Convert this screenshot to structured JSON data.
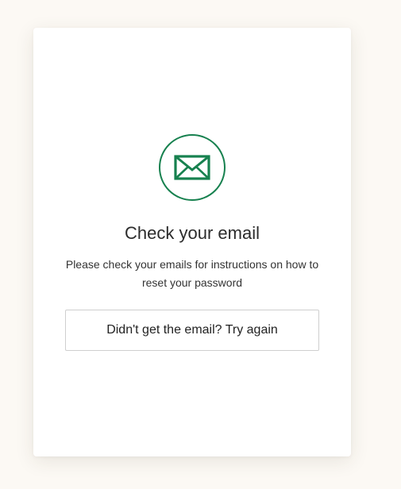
{
  "colors": {
    "accent": "#17814f",
    "page_background": "#fcf9f4",
    "card_background": "#ffffff"
  },
  "icon": "envelope-icon",
  "title": "Check your email",
  "message": "Please check your emails for instructions on how to reset your password",
  "retry_button_label": "Didn't get the email? Try again"
}
